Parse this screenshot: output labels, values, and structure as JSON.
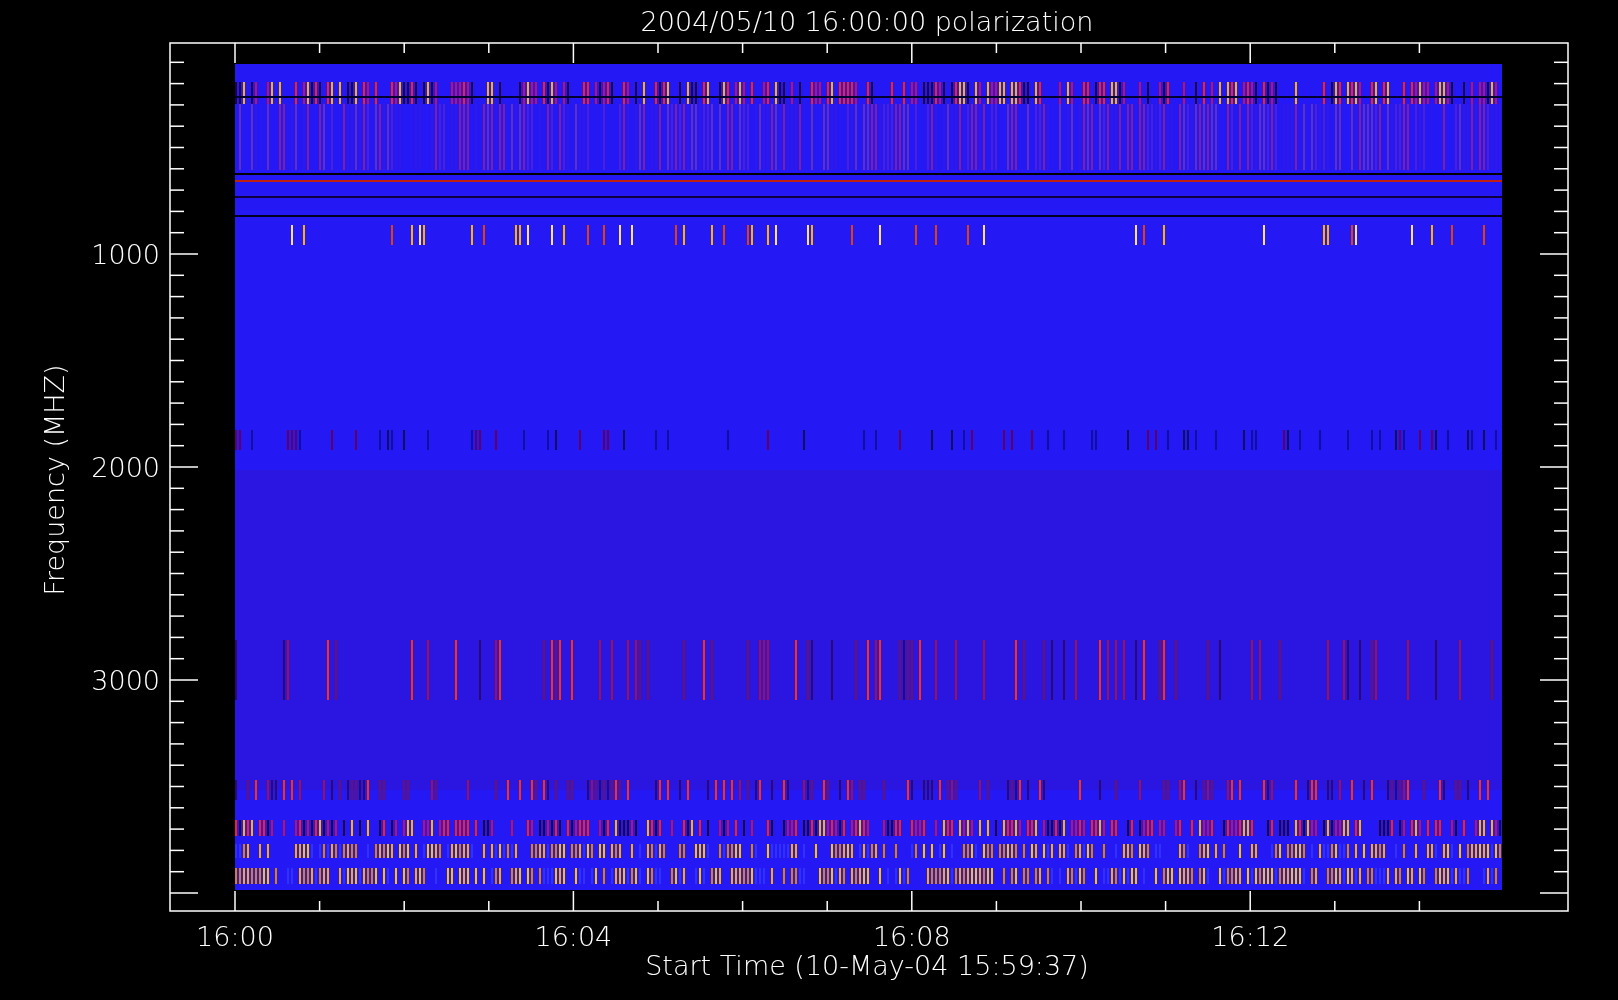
{
  "title": "2004/05/10 16:00:00 polarization",
  "x_axis": {
    "label": "Start Time (10-May-04 15:59:37)",
    "ticks": [
      "16:00",
      "16:04",
      "16:08",
      "16:12"
    ]
  },
  "y_axis": {
    "label": "Frequency (MHZ)",
    "ticks": [
      "1000",
      "2000",
      "3000"
    ]
  }
}
